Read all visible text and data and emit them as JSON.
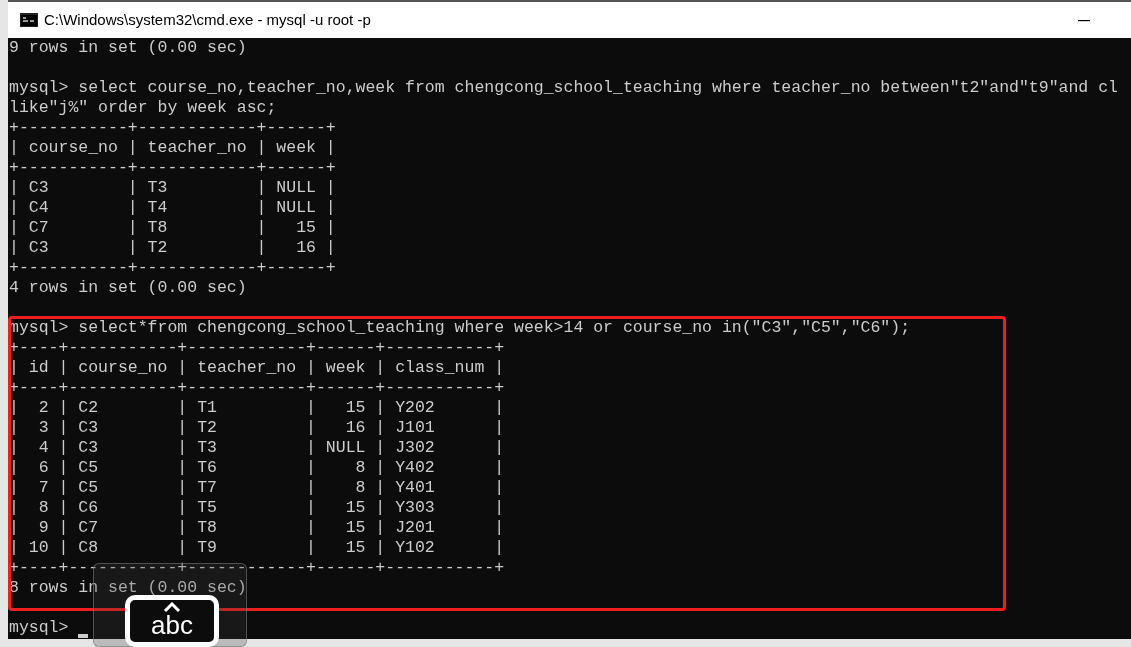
{
  "window": {
    "title": "C:\\Windows\\system32\\cmd.exe - mysql  -u root -p"
  },
  "console": {
    "lines": [
      {
        "kind": "text",
        "text": "9 rows in set (0.00 sec)"
      },
      {
        "kind": "blank"
      },
      {
        "kind": "text",
        "text": "mysql> select course_no,teacher_no,week from chengcong_school_teaching where teacher_no between\"t2\"and\"t9\"and cl"
      },
      {
        "kind": "text",
        "text": "like\"j%\" order by week asc;"
      },
      {
        "kind": "text",
        "text": "+-----------+------------+------+"
      },
      {
        "kind": "text",
        "text": "| course_no | teacher_no | week |"
      },
      {
        "kind": "text",
        "text": "+-----------+------------+------+"
      },
      {
        "kind": "text",
        "text": "| C3        | T3         | NULL |"
      },
      {
        "kind": "text",
        "text": "| C4        | T4         | NULL |"
      },
      {
        "kind": "text",
        "text": "| C7        | T8         |   15 |"
      },
      {
        "kind": "text",
        "text": "| C3        | T2         |   16 |"
      },
      {
        "kind": "text",
        "text": "+-----------+------------+------+"
      },
      {
        "kind": "text",
        "text": "4 rows in set (0.00 sec)"
      },
      {
        "kind": "blank"
      },
      {
        "kind": "text",
        "text": "mysql> select*from chengcong_school_teaching where week>14 or course_no in(\"C3\",\"C5\",\"C6\");"
      },
      {
        "kind": "text",
        "text": "+----+-----------+------------+------+-----------+"
      },
      {
        "kind": "text",
        "text": "| id | course_no | teacher_no | week | class_num |"
      },
      {
        "kind": "text",
        "text": "+----+-----------+------------+------+-----------+"
      },
      {
        "kind": "text",
        "text": "|  2 | C2        | T1         |   15 | Y202      |"
      },
      {
        "kind": "text",
        "text": "|  3 | C3        | T2         |   16 | J101      |"
      },
      {
        "kind": "text",
        "text": "|  4 | C3        | T3         | NULL | J302      |"
      },
      {
        "kind": "text",
        "text": "|  6 | C5        | T6         |    8 | Y402      |"
      },
      {
        "kind": "text",
        "text": "|  7 | C5        | T7         |    8 | Y401      |"
      },
      {
        "kind": "text",
        "text": "|  8 | C6        | T5         |   15 | Y303      |"
      },
      {
        "kind": "text",
        "text": "|  9 | C7        | T8         |   15 | J201      |"
      },
      {
        "kind": "text",
        "text": "| 10 | C8        | T9         |   15 | Y102      |"
      },
      {
        "kind": "text",
        "text": "+----+-----------+------------+------+-----------+"
      },
      {
        "kind": "text",
        "text": "8 rows in set (0.00 sec)"
      },
      {
        "kind": "blank"
      }
    ],
    "prompt": {
      "text": "mysql>",
      "cursor": true
    }
  },
  "ime_indicator": {
    "mode": "abc"
  }
}
